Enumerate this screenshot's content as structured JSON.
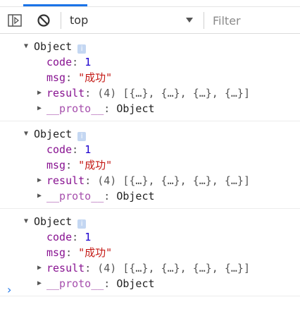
{
  "toolbar": {
    "context_label": "top",
    "filter_placeholder": "Filter"
  },
  "messages": [
    {
      "title": "Object",
      "badge": "i",
      "code_key": "code",
      "code_value": "1",
      "msg_key": "msg",
      "msg_value": "\"成功\"",
      "result_key": "result",
      "result_summary": "(4) [{…}, {…}, {…}, {…}]",
      "proto_key": "__proto__",
      "proto_value": "Object"
    },
    {
      "title": "Object",
      "badge": "i",
      "code_key": "code",
      "code_value": "1",
      "msg_key": "msg",
      "msg_value": "\"成功\"",
      "result_key": "result",
      "result_summary": "(4) [{…}, {…}, {…}, {…}]",
      "proto_key": "__proto__",
      "proto_value": "Object"
    },
    {
      "title": "Object",
      "badge": "i",
      "code_key": "code",
      "code_value": "1",
      "msg_key": "msg",
      "msg_value": "\"成功\"",
      "result_key": "result",
      "result_summary": "(4) [{…}, {…}, {…}, {…}]",
      "proto_key": "__proto__",
      "proto_value": "Object"
    }
  ],
  "prompt_symbol": "›",
  "colors": {
    "accent": "#1a73e8",
    "key": "#881391",
    "number": "#1c00cf",
    "string": "#c41a16",
    "badge": "#c4d7f2"
  }
}
